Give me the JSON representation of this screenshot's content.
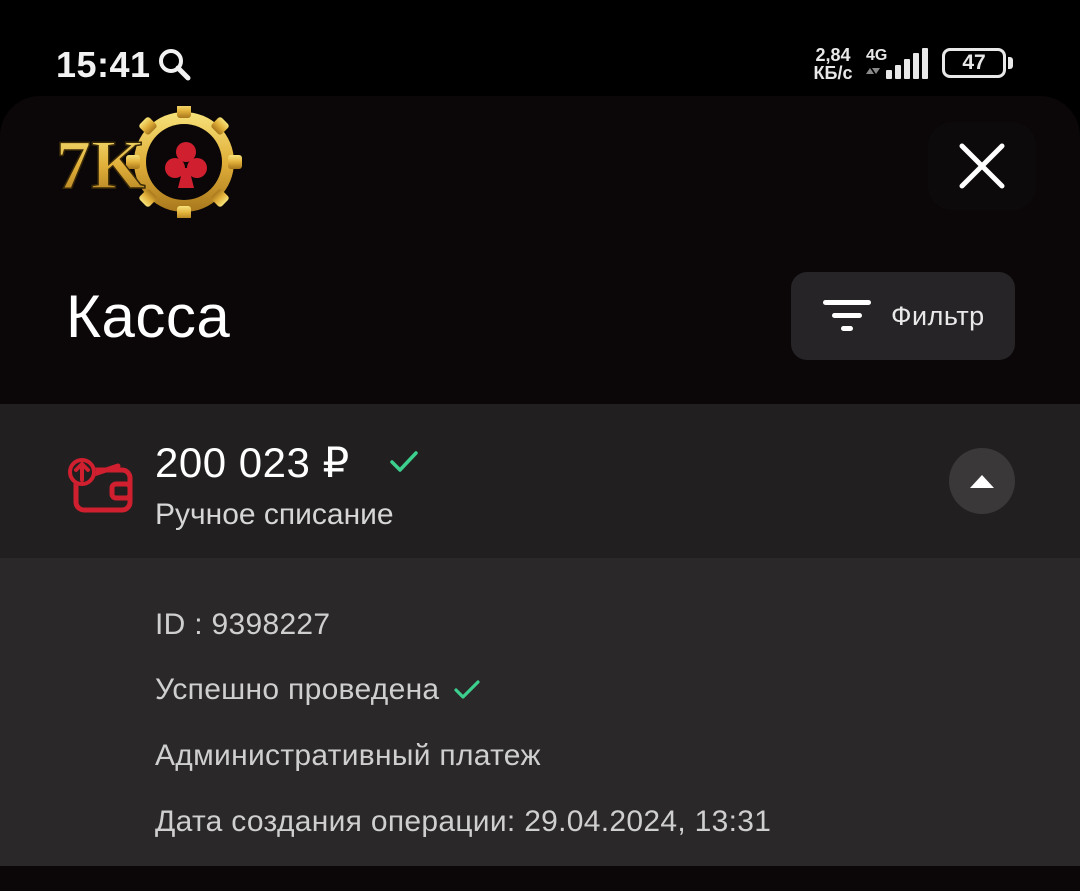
{
  "status_bar": {
    "time": "15:41",
    "net_speed_value": "2,84",
    "net_speed_unit": "КБ/с",
    "net_type": "4G",
    "battery": "47",
    "icons": [
      "search-icon",
      "signal-icon",
      "battery-icon"
    ]
  },
  "header": {
    "logo_text": "7K",
    "close_icon": "close-icon"
  },
  "page": {
    "title": "Касса",
    "filter_label": "Фильтр",
    "filter_icon": "filter-icon"
  },
  "transaction": {
    "amount": "200 023 ₽",
    "type": "Ручное списание",
    "status_icon": "check-icon",
    "icon": "wallet-outgoing-icon",
    "details": {
      "id": "ID : 9398227",
      "status": "Успешно проведена",
      "category": "Административный платеж",
      "created": "Дата создания операции: 29.04.2024, 13:31"
    }
  },
  "colors": {
    "accent_red": "#d01f2e",
    "success_green": "#3ccf8e",
    "gold": "#e8b73a",
    "panel_bg": "#0b0708",
    "row_bg": "#211f20",
    "details_bg": "#2a2829"
  }
}
